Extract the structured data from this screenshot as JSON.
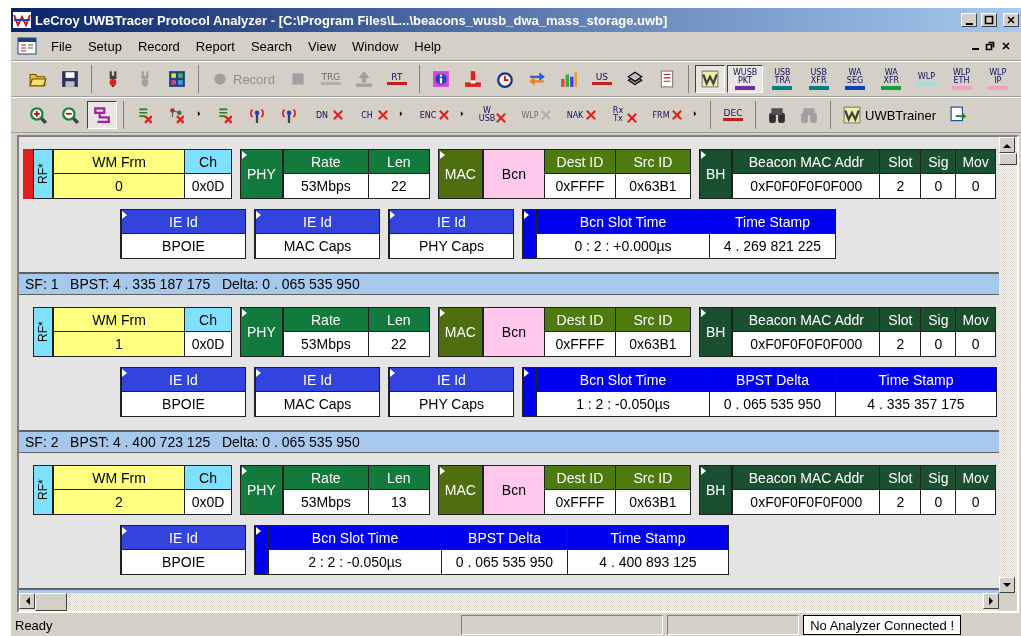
{
  "window": {
    "title": "LeCroy UWBTracer Protocol Analyzer - [C:\\Program Files\\L...\\beacons_wusb_dwa_mass_storage.uwb]"
  },
  "menu": [
    "File",
    "Setup",
    "Record",
    "Report",
    "Search",
    "View",
    "Window",
    "Help"
  ],
  "toolbars": [
    [
      [
        {
          "kind": "open",
          "disabled": false,
          "pressed": false
        },
        {
          "kind": "save",
          "disabled": false,
          "pressed": false
        }
      ],
      [
        {
          "kind": "tool",
          "disabled": false,
          "pressed": false
        },
        {
          "kind": "tool",
          "disabled": true,
          "pressed": false
        },
        {
          "kind": "grid",
          "disabled": false,
          "pressed": false
        }
      ],
      [
        {
          "kind": "record",
          "text": "Record",
          "disabled": true,
          "pressed": false
        },
        {
          "kind": "stop",
          "disabled": true,
          "pressed": false
        },
        {
          "kind": "trg",
          "text": "TRG",
          "disabled": true,
          "pressed": false
        },
        {
          "kind": "upload",
          "disabled": true,
          "pressed": false
        },
        {
          "kind": "rt",
          "text": "RT",
          "disabled": false,
          "pressed": false
        }
      ],
      [
        {
          "kind": "info",
          "disabled": false,
          "pressed": false
        },
        {
          "kind": "alert",
          "disabled": false,
          "pressed": false
        },
        {
          "kind": "clock",
          "disabled": false,
          "pressed": false
        },
        {
          "kind": "swap",
          "disabled": false,
          "pressed": false
        },
        {
          "kind": "bars",
          "disabled": false,
          "pressed": false
        },
        {
          "kind": "ruler",
          "text": "US",
          "disabled": false,
          "pressed": false
        },
        {
          "kind": "layers",
          "disabled": false,
          "pressed": false
        },
        {
          "kind": "list",
          "disabled": false,
          "pressed": false
        }
      ],
      [
        {
          "kind": "logo",
          "disabled": false,
          "pressed": true
        },
        {
          "kind": "tag",
          "text": "WUSB PKT",
          "color": "#7030a0",
          "disabled": false,
          "pressed": true
        },
        {
          "kind": "tag",
          "text": "USB TRA",
          "color": "#008080",
          "disabled": false,
          "pressed": false
        },
        {
          "kind": "tag",
          "text": "USB XFR",
          "color": "#008080",
          "disabled": false,
          "pressed": false
        },
        {
          "kind": "tag",
          "text": "WA SEG",
          "color": "#1040c0",
          "disabled": false,
          "pressed": false
        },
        {
          "kind": "tag",
          "text": "WA XFR",
          "color": "#10a040",
          "disabled": false,
          "pressed": false
        },
        {
          "kind": "tag",
          "text": "WLP",
          "color": "#a0e0d8",
          "disabled": false,
          "pressed": false
        },
        {
          "kind": "tag",
          "text": "WLP ETH",
          "color": "#f0a0b8",
          "disabled": false,
          "pressed": false
        },
        {
          "kind": "tag",
          "text": "WLP IP",
          "color": "#f0a0b8",
          "disabled": false,
          "pressed": false
        }
      ]
    ],
    [
      [
        {
          "kind": "zoomin",
          "disabled": false,
          "pressed": false
        },
        {
          "kind": "zoomout",
          "disabled": false,
          "pressed": false
        },
        {
          "kind": "toggle",
          "disabled": false,
          "pressed": true
        }
      ],
      [
        {
          "kind": "filter",
          "disabled": false,
          "pressed": false
        },
        {
          "kind": "tree",
          "disabled": false,
          "pressed": false
        },
        {
          "kind": "more",
          "disabled": false,
          "pressed": false
        },
        {
          "kind": "filter",
          "disabled": false,
          "pressed": false
        },
        {
          "kind": "antenna",
          "disabled": false,
          "pressed": false
        },
        {
          "kind": "antenna",
          "disabled": false,
          "pressed": false
        },
        {
          "kind": "filter",
          "text": "DN",
          "disabled": false,
          "pressed": false
        },
        {
          "kind": "filter",
          "text": "CH",
          "disabled": false,
          "pressed": false
        },
        {
          "kind": "more",
          "disabled": false,
          "pressed": false
        },
        {
          "kind": "filter",
          "text": "ENC",
          "disabled": false,
          "pressed": false
        },
        {
          "kind": "more",
          "disabled": false,
          "pressed": false
        },
        {
          "kind": "filter",
          "text": "W USB",
          "disabled": false,
          "pressed": false
        },
        {
          "kind": "filter",
          "text": "WLP",
          "disabled": true,
          "pressed": false
        },
        {
          "kind": "filter",
          "text": "NAK",
          "disabled": false,
          "pressed": false
        },
        {
          "kind": "filter",
          "text": "Rx Tx",
          "disabled": false,
          "pressed": false
        },
        {
          "kind": "filter",
          "text": "FRM",
          "disabled": false,
          "pressed": false
        },
        {
          "kind": "more",
          "disabled": false,
          "pressed": false
        }
      ],
      [
        {
          "kind": "dec",
          "text": "DEC",
          "disabled": false,
          "pressed": false
        }
      ],
      [
        {
          "kind": "binoculars",
          "disabled": false,
          "pressed": false
        },
        {
          "kind": "binoculars",
          "disabled": true,
          "pressed": false
        }
      ],
      [
        {
          "kind": "trainer",
          "text": "UWBTrainer",
          "disabled": false,
          "pressed": false
        },
        {
          "kind": "export",
          "disabled": false,
          "pressed": false
        }
      ]
    ]
  ],
  "trace": [
    {
      "kind": "packet",
      "marked": true,
      "rows": [
        [
          {
            "kind": "rf",
            "label": "RF*",
            "fields": [
              {
                "name": "WM Frm",
                "value": "0"
              },
              {
                "name": "Ch",
                "value": "0x0D"
              }
            ]
          },
          {
            "kind": "phy",
            "label": "PHY",
            "fields": [
              {
                "name": "Rate",
                "value": "53Mbps"
              },
              {
                "name": "Len",
                "value": "22"
              }
            ]
          },
          {
            "kind": "mac",
            "label": "MAC",
            "fields": [
              {
                "value": "Bcn"
              },
              {
                "name": "Dest ID",
                "value": "0xFFFF"
              },
              {
                "name": "Src ID",
                "value": "0x63B1"
              }
            ]
          },
          {
            "kind": "bh",
            "label": "BH",
            "fields": [
              {
                "name": "Beacon MAC Addr",
                "value": "0xF0F0F0F0F000"
              },
              {
                "name": "Slot",
                "value": "2"
              },
              {
                "name": "Sig",
                "value": "0"
              },
              {
                "name": "Mov",
                "value": "0"
              }
            ]
          }
        ],
        [
          {
            "kind": "ie",
            "fields": [
              {
                "name": "IE Id",
                "value": "BPOIE"
              }
            ]
          },
          {
            "kind": "ie",
            "fields": [
              {
                "name": "IE Id",
                "value": "MAC Caps"
              }
            ]
          },
          {
            "kind": "ie",
            "fields": [
              {
                "name": "IE Id",
                "value": "PHY Caps"
              }
            ]
          },
          {
            "kind": "slot",
            "fields": [
              {
                "name": "Bcn Slot Time",
                "value": "0 : 2 : +0.000µs"
              },
              {
                "name": "Time Stamp",
                "value": "4 . 269 821 225"
              }
            ]
          }
        ]
      ]
    },
    {
      "kind": "sf",
      "text": "SF: 1   BPST: 4 . 335 187 175   Delta: 0 . 065 535 950"
    },
    {
      "kind": "packet",
      "marked": false,
      "rows": [
        [
          {
            "kind": "rf",
            "label": "RF*",
            "fields": [
              {
                "name": "WM Frm",
                "value": "1"
              },
              {
                "name": "Ch",
                "value": "0x0D"
              }
            ]
          },
          {
            "kind": "phy",
            "label": "PHY",
            "fields": [
              {
                "name": "Rate",
                "value": "53Mbps"
              },
              {
                "name": "Len",
                "value": "22"
              }
            ]
          },
          {
            "kind": "mac",
            "label": "MAC",
            "fields": [
              {
                "value": "Bcn"
              },
              {
                "name": "Dest ID",
                "value": "0xFFFF"
              },
              {
                "name": "Src ID",
                "value": "0x63B1"
              }
            ]
          },
          {
            "kind": "bh",
            "label": "BH",
            "fields": [
              {
                "name": "Beacon MAC Addr",
                "value": "0xF0F0F0F0F000"
              },
              {
                "name": "Slot",
                "value": "2"
              },
              {
                "name": "Sig",
                "value": "0"
              },
              {
                "name": "Mov",
                "value": "0"
              }
            ]
          }
        ],
        [
          {
            "kind": "ie",
            "fields": [
              {
                "name": "IE Id",
                "value": "BPOIE"
              }
            ]
          },
          {
            "kind": "ie",
            "fields": [
              {
                "name": "IE Id",
                "value": "MAC Caps"
              }
            ]
          },
          {
            "kind": "ie",
            "fields": [
              {
                "name": "IE Id",
                "value": "PHY Caps"
              }
            ]
          },
          {
            "kind": "slot",
            "fields": [
              {
                "name": "Bcn Slot Time",
                "value": "1 : 2 : -0.050µs"
              },
              {
                "name": "BPST Delta",
                "value": "0 . 065 535 950"
              },
              {
                "name": "Time Stamp",
                "value": "4 . 335 357 175"
              }
            ]
          }
        ]
      ]
    },
    {
      "kind": "sf",
      "text": "SF: 2   BPST: 4 . 400 723 125   Delta: 0 . 065 535 950"
    },
    {
      "kind": "packet",
      "marked": false,
      "rows": [
        [
          {
            "kind": "rf",
            "label": "RF*",
            "fields": [
              {
                "name": "WM Frm",
                "value": "2"
              },
              {
                "name": "Ch",
                "value": "0x0D"
              }
            ]
          },
          {
            "kind": "phy",
            "label": "PHY",
            "fields": [
              {
                "name": "Rate",
                "value": "53Mbps"
              },
              {
                "name": "Len",
                "value": "13"
              }
            ]
          },
          {
            "kind": "mac",
            "label": "MAC",
            "fields": [
              {
                "value": "Bcn"
              },
              {
                "name": "Dest ID",
                "value": "0xFFFF"
              },
              {
                "name": "Src ID",
                "value": "0x63B1"
              }
            ]
          },
          {
            "kind": "bh",
            "label": "BH",
            "fields": [
              {
                "name": "Beacon MAC Addr",
                "value": "0xF0F0F0F0F000"
              },
              {
                "name": "Slot",
                "value": "2"
              },
              {
                "name": "Sig",
                "value": "0"
              },
              {
                "name": "Mov",
                "value": "0"
              }
            ]
          }
        ],
        [
          {
            "kind": "ie",
            "fields": [
              {
                "name": "IE Id",
                "value": "BPOIE"
              }
            ]
          },
          {
            "kind": "slot",
            "fields": [
              {
                "name": "Bcn Slot Time",
                "value": "2 : 2 : -0.050µs"
              },
              {
                "name": "BPST Delta",
                "value": "0 . 065 535 950"
              },
              {
                "name": "Time Stamp",
                "value": "4 . 400 893 125"
              }
            ]
          }
        ]
      ]
    }
  ],
  "status_bar": {
    "message": "Ready",
    "analyzer": "No Analyzer Connected !"
  }
}
